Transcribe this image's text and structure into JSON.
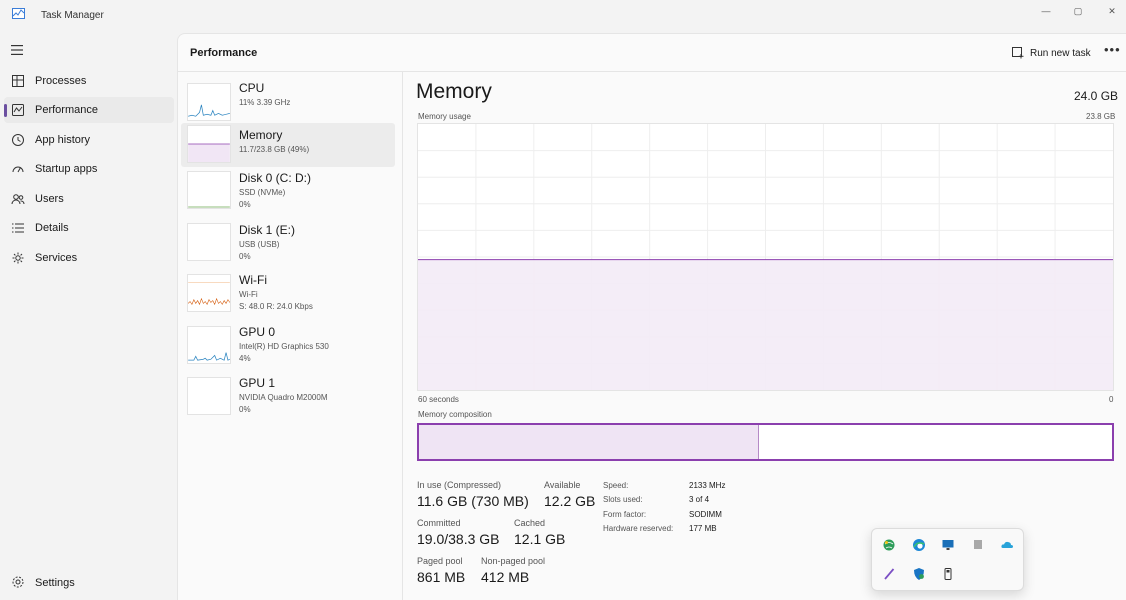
{
  "window": {
    "title": "Task Manager",
    "minimize": "—",
    "maximize": "▢",
    "close": "✕"
  },
  "nav": {
    "items": [
      {
        "label": "Processes",
        "icon": "processes-grid-icon"
      },
      {
        "label": "Performance",
        "icon": "performance-chart-icon"
      },
      {
        "label": "App history",
        "icon": "history-clock-icon"
      },
      {
        "label": "Startup apps",
        "icon": "startup-gauge-icon"
      },
      {
        "label": "Users",
        "icon": "users-icon"
      },
      {
        "label": "Details",
        "icon": "details-list-icon"
      },
      {
        "label": "Services",
        "icon": "services-puzzle-icon"
      }
    ],
    "settings_label": "Settings"
  },
  "header": {
    "title": "Performance",
    "run_new_task": "Run new task",
    "more": "•••"
  },
  "devices": [
    {
      "name": "CPU",
      "lines": [
        "11%  3.39 GHz"
      ]
    },
    {
      "name": "Memory",
      "lines": [
        "11.7/23.8 GB (49%)"
      ]
    },
    {
      "name": "Disk 0 (C: D:)",
      "lines": [
        "SSD (NVMe)",
        "0%"
      ]
    },
    {
      "name": "Disk 1 (E:)",
      "lines": [
        "USB (USB)",
        "0%"
      ]
    },
    {
      "name": "Wi-Fi",
      "lines": [
        "Wi-Fi",
        "S: 48.0  R: 24.0 Kbps"
      ]
    },
    {
      "name": "GPU 0",
      "lines": [
        "Intel(R) HD Graphics 530",
        "4%"
      ]
    },
    {
      "name": "GPU 1",
      "lines": [
        "NVIDIA Quadro M2000M",
        "0%"
      ]
    }
  ],
  "memory": {
    "title": "Memory",
    "total": "24.0 GB",
    "usage_label": "Memory usage",
    "usage_max": "23.8 GB",
    "axis_left": "60 seconds",
    "axis_right": "0",
    "usage_fraction": 0.49,
    "composition_label": "Memory composition",
    "composition_in_use_fraction": 0.49,
    "accent": "#8b3fae",
    "stats": {
      "in_use_label": "In use (Compressed)",
      "in_use": "11.6 GB (730 MB)",
      "available_label": "Available",
      "available": "12.2 GB",
      "committed_label": "Committed",
      "committed": "19.0/38.3 GB",
      "cached_label": "Cached",
      "cached": "12.1 GB",
      "paged_label": "Paged pool",
      "paged": "861 MB",
      "nonpaged_label": "Non-paged pool",
      "nonpaged": "412 MB"
    },
    "specs": [
      {
        "label": "Speed:",
        "value": "2133 MHz"
      },
      {
        "label": "Slots used:",
        "value": "3 of 4"
      },
      {
        "label": "Form factor:",
        "value": "SODIMM"
      },
      {
        "label": "Hardware reserved:",
        "value": "177 MB"
      }
    ]
  },
  "tray_icons": [
    "globe-network-icon",
    "edge-browser-icon",
    "display-monitor-icon",
    "gray-square-icon",
    "onedrive-cloud-icon",
    "pen-icon",
    "defender-shield-icon",
    "usb-eject-icon"
  ]
}
